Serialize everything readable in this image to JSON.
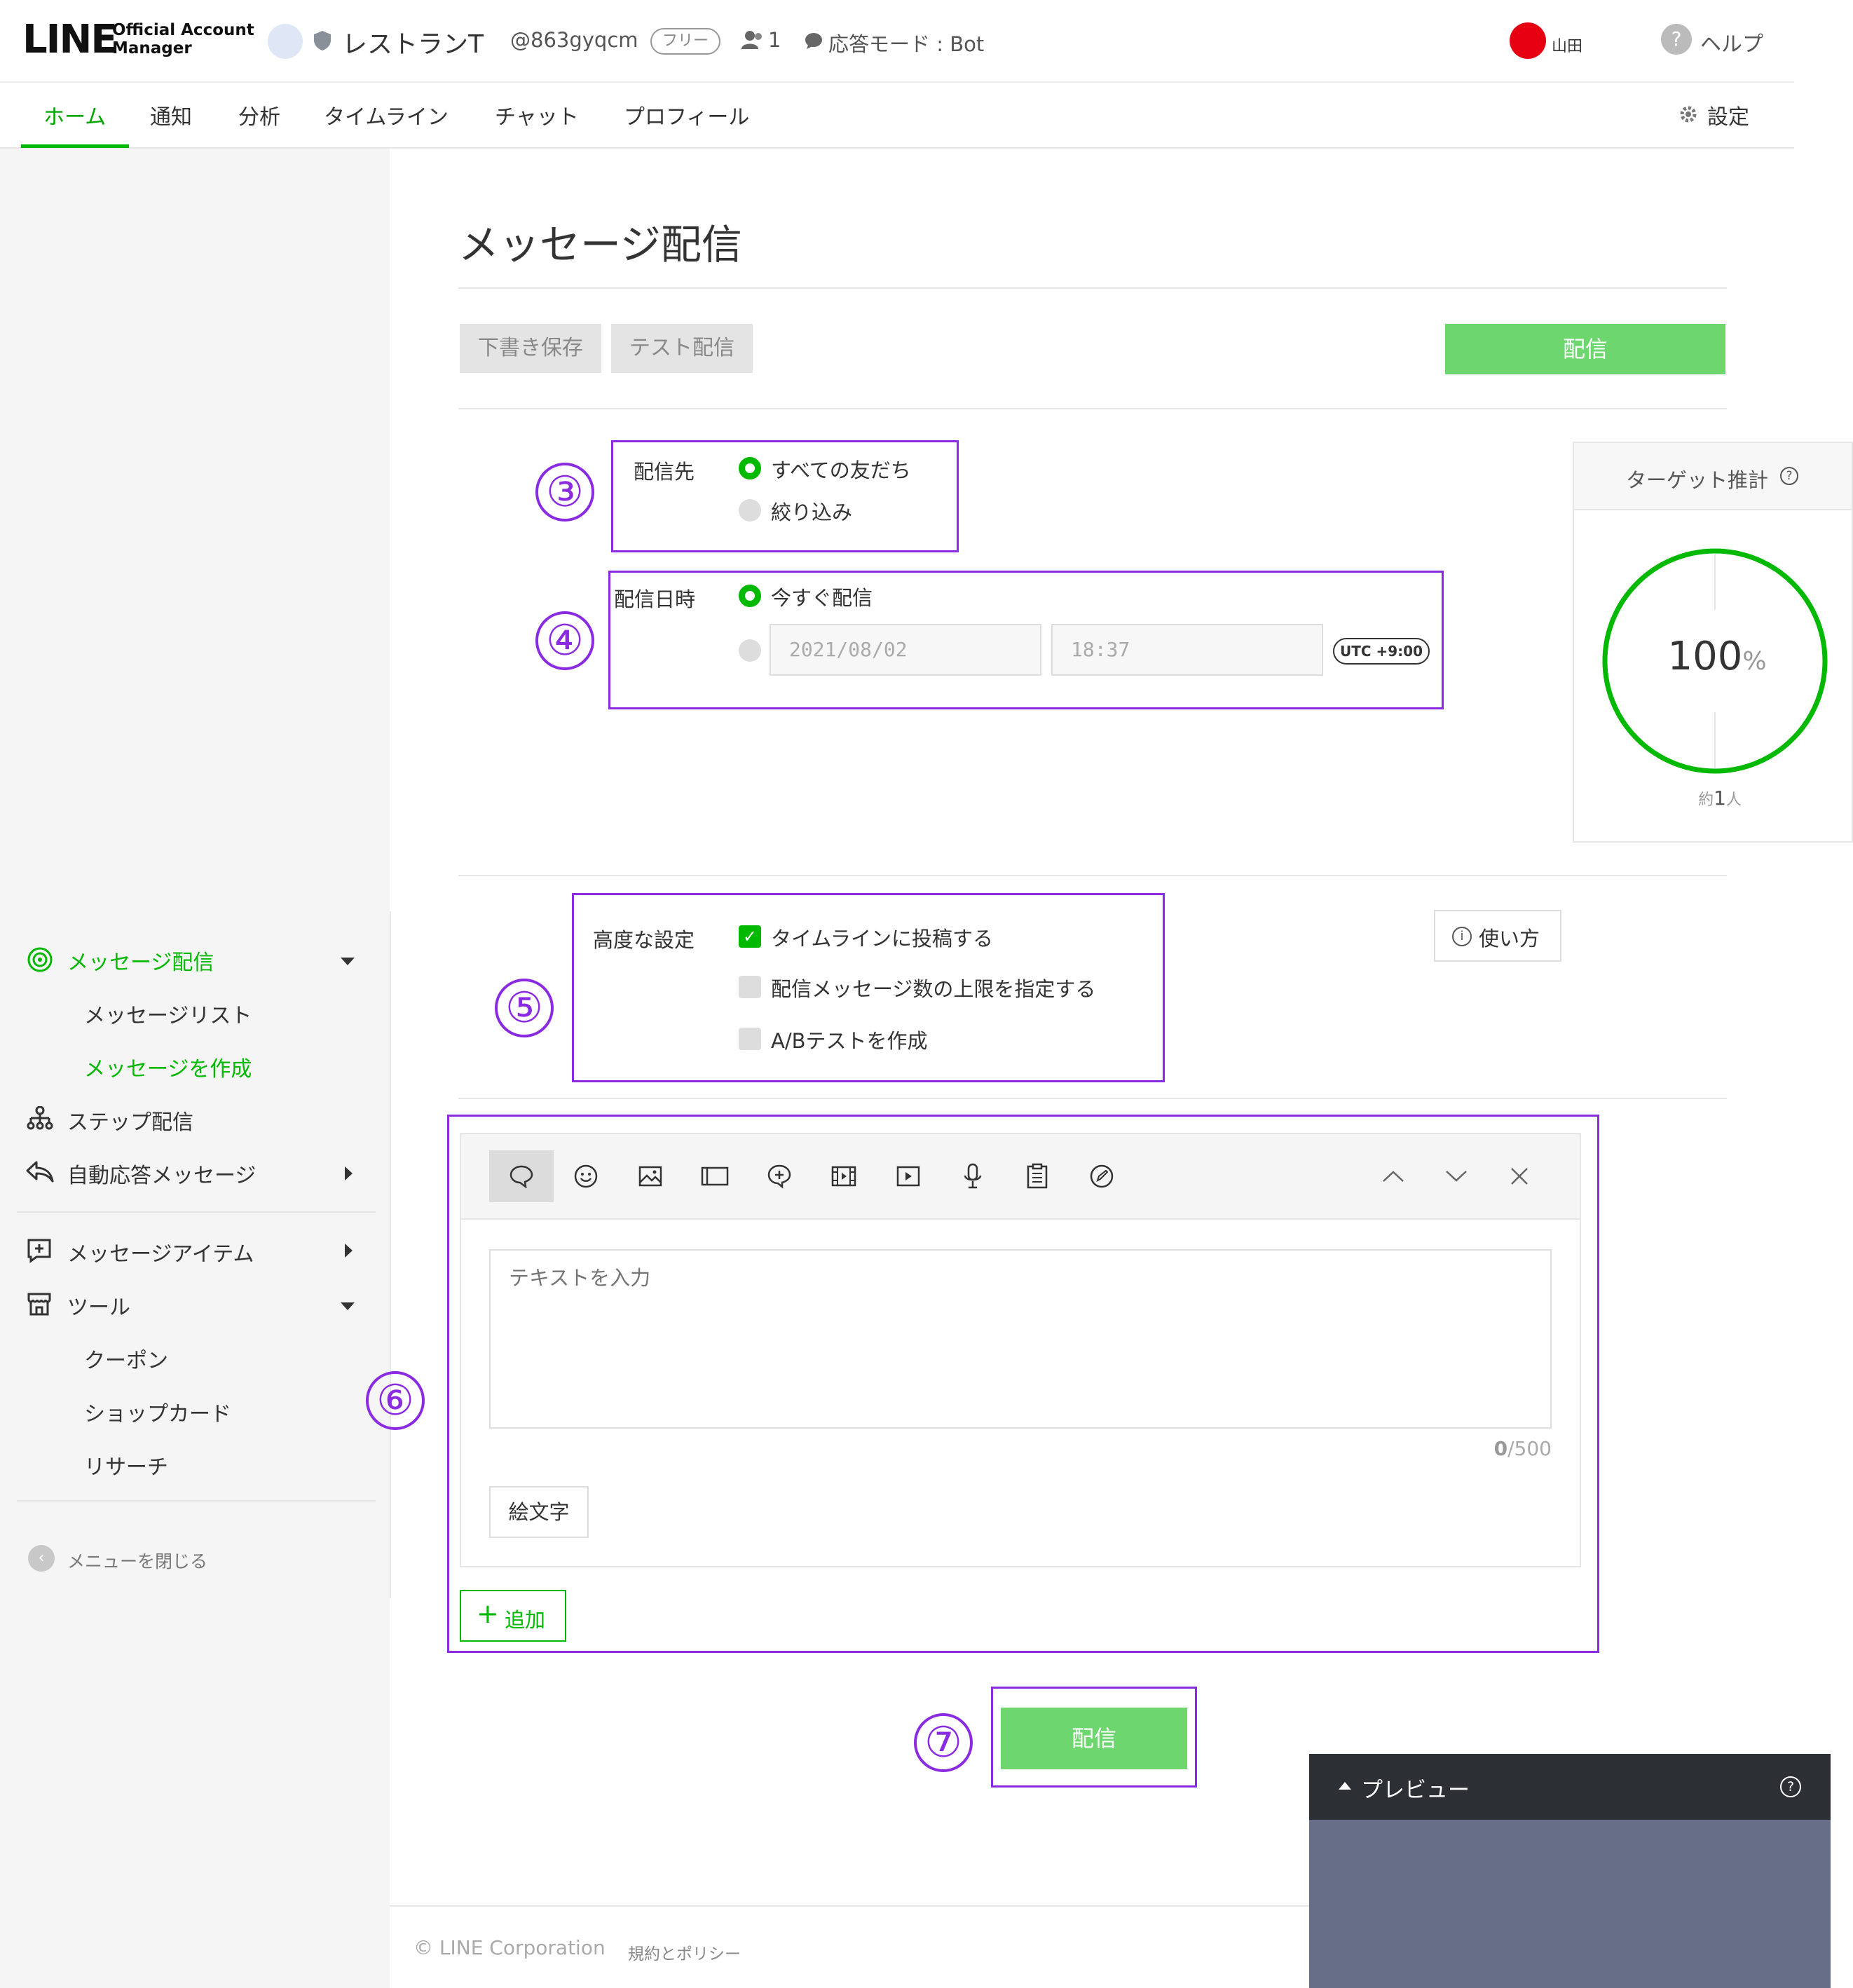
{
  "header": {
    "logo_main": "LINE",
    "logo_sub_1": "Official Account",
    "logo_sub_2": "Manager",
    "account_name": "レストランT",
    "account_id": "@863gyqcm",
    "plan_badge": "フリー",
    "friends_count": "1",
    "response_mode": "応答モード : Bot",
    "user_name": "山田",
    "help_label": "ヘルプ"
  },
  "nav": {
    "tabs": [
      "ホーム",
      "通知",
      "分析",
      "タイムライン",
      "チャット",
      "プロフィール"
    ],
    "settings_label": "設定"
  },
  "sidebar": {
    "message_delivery": "メッセージ配信",
    "message_list": "メッセージリスト",
    "create_message": "メッセージを作成",
    "step_delivery": "ステップ配信",
    "auto_response": "自動応答メッセージ",
    "message_items": "メッセージアイテム",
    "tools": "ツール",
    "coupon": "クーポン",
    "shop_card": "ショップカード",
    "research": "リサーチ",
    "close_menu": "メニューを閉じる"
  },
  "page": {
    "title": "メッセージ配信",
    "save_draft": "下書き保存",
    "test_send": "テスト配信",
    "send": "配信"
  },
  "recipients": {
    "label": "配信先",
    "option_all": "すべての友だち",
    "option_filter": "絞り込み"
  },
  "schedule": {
    "label": "配信日時",
    "option_now": "今すぐ配信",
    "date": "2021/08/02",
    "time": "18:37",
    "timezone": "UTC +9:00"
  },
  "target": {
    "title": "ターゲット推計",
    "percent": "100",
    "percent_unit": "%",
    "approx_prefix": "約",
    "approx_count": "1",
    "approx_suffix": "人",
    "fraction": 1.0
  },
  "advanced": {
    "label": "高度な設定",
    "post_timeline": "タイムラインに投稿する",
    "limit_messages": "配信メッセージ数の上限を指定する",
    "ab_test": "A/Bテストを作成",
    "howto": "使い方"
  },
  "editor": {
    "placeholder": "テキストを入力",
    "count_current": "0",
    "count_max": "/500",
    "emoji_button": "絵文字",
    "add_button": "追加"
  },
  "annotations": [
    "③",
    "④",
    "⑤",
    "⑥",
    "⑦"
  ],
  "preview": {
    "label": "プレビュー"
  },
  "footer": {
    "copyright": "© LINE Corporation",
    "policy": "規約とポリシー"
  },
  "colors": {
    "brand_green": "#00b900",
    "button_green": "#6ed66e",
    "annotation_purple": "#8a2be2"
  }
}
